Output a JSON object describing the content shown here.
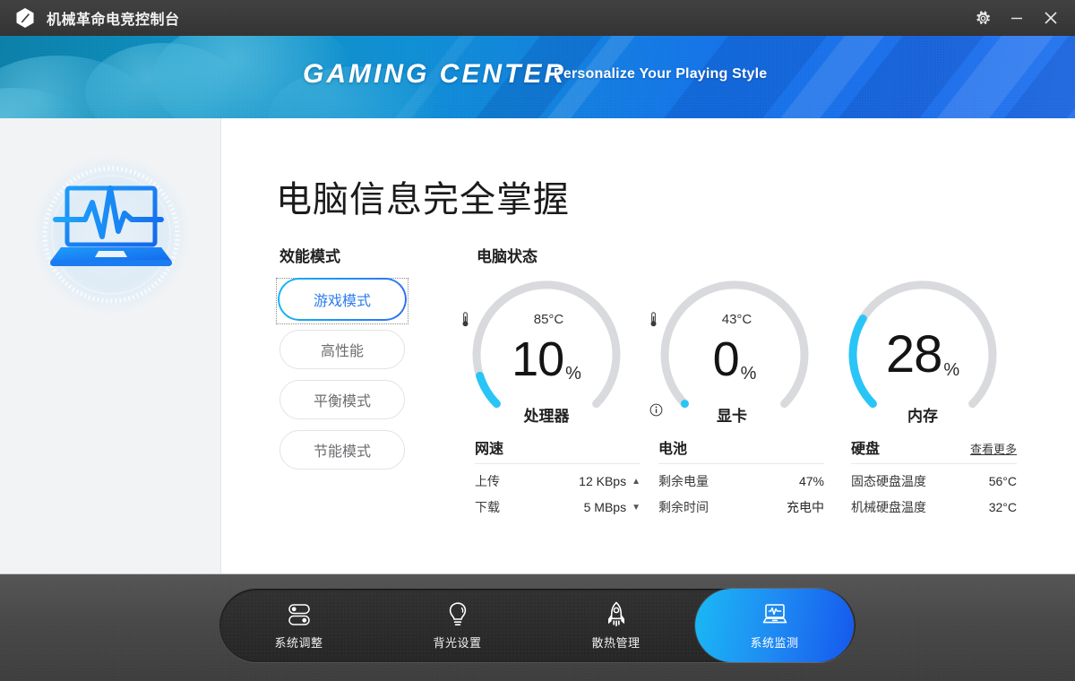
{
  "titlebar": {
    "logo_icon": "hexagon-logo-icon",
    "title": "机械革命电竞控制台",
    "buttons": [
      {
        "name": "settings-button",
        "icon": "gear-icon"
      },
      {
        "name": "minimize-button",
        "icon": "minimize-icon"
      },
      {
        "name": "close-button",
        "icon": "close-icon"
      }
    ]
  },
  "banner": {
    "title": "GAMING CENTER",
    "subtitle": "Personalize Your Playing Style"
  },
  "sidebar": {
    "hero_icon": "laptop-pulse-monitor-icon"
  },
  "main": {
    "page_title": "电脑信息完全掌握",
    "performance": {
      "label": "效能模式",
      "modes": [
        {
          "label": "游戏模式",
          "active": true
        },
        {
          "label": "高性能",
          "active": false
        },
        {
          "label": "平衡模式",
          "active": false
        },
        {
          "label": "节能模式",
          "active": false
        }
      ]
    },
    "status": {
      "label": "电脑状态",
      "gauges": [
        {
          "name": "处理器",
          "value": "10",
          "unit": "%",
          "percent": 10,
          "temp": "85°C",
          "has_temp": true,
          "has_info": false
        },
        {
          "name": "显卡",
          "value": "0",
          "unit": "%",
          "percent": 0,
          "temp": "43°C",
          "has_temp": true,
          "has_info": true
        },
        {
          "name": "内存",
          "value": "28",
          "unit": "%",
          "percent": 28,
          "temp": "",
          "has_temp": false,
          "has_info": false
        }
      ]
    },
    "stats": [
      {
        "title": "网速",
        "more": "",
        "rows": [
          {
            "key": "上传",
            "value": "12 KBps",
            "arrow": "▲"
          },
          {
            "key": "下载",
            "value": "5 MBps",
            "arrow": "▼"
          }
        ]
      },
      {
        "title": "电池",
        "more": "",
        "rows": [
          {
            "key": "剩余电量",
            "value": "47%",
            "arrow": ""
          },
          {
            "key": "剩余时间",
            "value": "充电中",
            "arrow": ""
          }
        ]
      },
      {
        "title": "硬盘",
        "more": "查看更多",
        "rows": [
          {
            "key": "固态硬盘温度",
            "value": "56°C",
            "arrow": ""
          },
          {
            "key": "机械硬盘温度",
            "value": "32°C",
            "arrow": ""
          }
        ]
      }
    ]
  },
  "footer": {
    "nav": [
      {
        "label": "系统调整",
        "icon": "toggle-switches-icon",
        "active": false
      },
      {
        "label": "背光设置",
        "icon": "lightbulb-icon",
        "active": false
      },
      {
        "label": "散热管理",
        "icon": "rocket-icon",
        "active": false
      },
      {
        "label": "系统监测",
        "icon": "laptop-pulse-icon",
        "active": true
      }
    ]
  },
  "colors": {
    "accent_cyan": "#29c5f6",
    "accent_blue": "#1a6ef0",
    "track_gray": "#d9dadd",
    "titlebar": "#3a3a3a",
    "footer": "#4a4a4a"
  }
}
